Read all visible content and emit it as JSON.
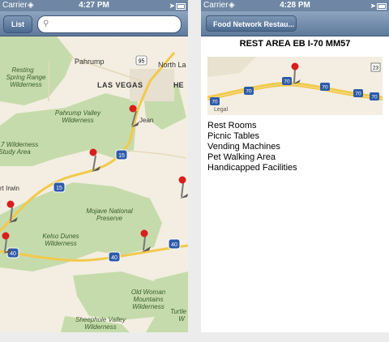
{
  "left_screen": {
    "status": {
      "carrier": "Carrier",
      "time": "4:27 PM"
    },
    "list_button": "List",
    "search": {
      "placeholder": "",
      "value": ""
    },
    "map_labels": {
      "pahrump": "Pahrump",
      "north_las": "North La",
      "resting1": "Resting",
      "resting2": "Spring Range",
      "resting3": "Wilderness",
      "las_vegas": "LAS VEGAS",
      "he": "HE",
      "jean": "Jean",
      "pv1": "Pahrump Valley",
      "pv2": "Wilderness",
      "w17a": "17 Wilderness",
      "w17b": "Study Area",
      "irwin": "rt Irwin",
      "mojave1": "Mojave National",
      "mojave2": "Preserve",
      "kelso1": "Kelso Dunes",
      "kelso2": "Wilderness",
      "ow1": "Old Woman",
      "ow2": "Mountains",
      "ow3": "Wilderness",
      "turtle1": "Turtle",
      "turtle2": "W",
      "sv1": "Sheephole Valley",
      "sv2": "Wilderness"
    },
    "shields": [
      "95",
      "15",
      "15",
      "40",
      "40",
      "40"
    ]
  },
  "right_screen": {
    "status": {
      "carrier": "Carrier",
      "time": "4:28 PM"
    },
    "back_button": "Food Network Restau...",
    "title": "REST AREA EB I-70 MM57",
    "thumbnail": {
      "legal": "Legal",
      "shields": [
        "70",
        "70",
        "70",
        "70",
        "70",
        "70",
        "23"
      ]
    },
    "amenities": [
      "Rest Rooms",
      "Picnic Tables",
      "Vending Machines",
      "Pet Walking Area",
      "Handicapped Facilities"
    ]
  },
  "colors": {
    "nav_bar": "#6f87a4",
    "map_land": "#f3eee1",
    "map_park": "#c6dbab",
    "highway": "#f2c94c",
    "interstate": "#2e5aa8",
    "pin": "#d91e1e"
  },
  "icons": [
    "wifi-icon",
    "location-arrow-icon",
    "battery-icon",
    "search-icon",
    "map-pin-icon"
  ]
}
